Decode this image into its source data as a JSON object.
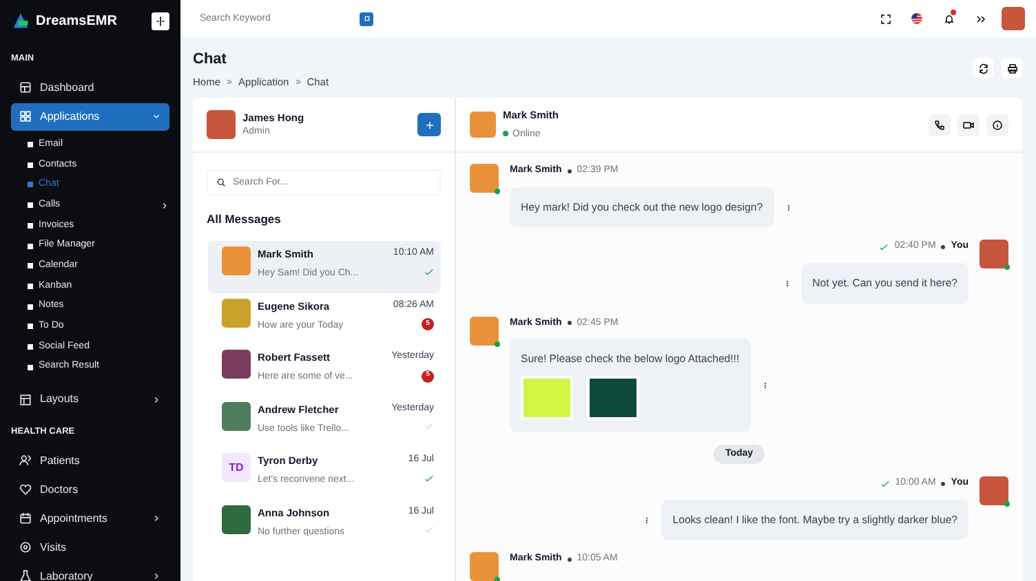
{
  "brand": {
    "name": "DreamsEMR"
  },
  "sidebar": {
    "sections": [
      {
        "title": "MAIN",
        "items": [
          {
            "label": "Dashboard",
            "selected": false,
            "has_submenu": false
          },
          {
            "label": "Applications",
            "selected": true,
            "has_submenu": true,
            "expanded": true,
            "children": [
              {
                "label": "Email",
                "selected": false,
                "has_submenu": false
              },
              {
                "label": "Contacts",
                "selected": false,
                "has_submenu": false
              },
              {
                "label": "Chat",
                "selected": true,
                "has_submenu": false
              },
              {
                "label": "Calls",
                "selected": false,
                "has_submenu": true
              },
              {
                "label": "Invoices",
                "selected": false,
                "has_submenu": false
              },
              {
                "label": "File Manager",
                "selected": false,
                "has_submenu": false
              },
              {
                "label": "Calendar",
                "selected": false,
                "has_submenu": false
              },
              {
                "label": "Kanban",
                "selected": false,
                "has_submenu": false
              },
              {
                "label": "Notes",
                "selected": false,
                "has_submenu": false
              },
              {
                "label": "To Do",
                "selected": false,
                "has_submenu": false
              },
              {
                "label": "Social Feed",
                "selected": false,
                "has_submenu": false
              },
              {
                "label": "Search Result",
                "selected": false,
                "has_submenu": false
              }
            ]
          },
          {
            "label": "Layouts",
            "selected": false,
            "has_submenu": true
          }
        ]
      },
      {
        "title": "HEALTH CARE",
        "items": [
          {
            "label": "Patients",
            "selected": false,
            "has_submenu": false
          },
          {
            "label": "Doctors",
            "selected": false,
            "has_submenu": false
          },
          {
            "label": "Appointments",
            "selected": false,
            "has_submenu": true
          },
          {
            "label": "Visits",
            "selected": false,
            "has_submenu": false
          },
          {
            "label": "Laboratory",
            "selected": false,
            "has_submenu": true
          }
        ]
      }
    ]
  },
  "topbar": {
    "search": {
      "placeholder": "Search Keyword"
    },
    "notification_dot": true
  },
  "page": {
    "title": "Chat",
    "breadcrumb": [
      "Home",
      "Application",
      "Chat"
    ]
  },
  "chat_list": {
    "user": {
      "name": "James Hong",
      "role": "Admin"
    },
    "search": {
      "placeholder": "Search For..."
    },
    "heading": "All Messages",
    "items": [
      {
        "name": "Mark Smith",
        "preview": "Hey Sam! Did you Ch...",
        "time": "10:10 AM",
        "read": true,
        "selected": true
      },
      {
        "name": "Eugene Sikora",
        "preview": "How are your Today",
        "time": "08:26 AM",
        "count": "5",
        "selected": false
      },
      {
        "name": "Robert Fassett",
        "preview": "Here are some of ve...",
        "time": "Yesterday",
        "count": "5",
        "selected": false
      },
      {
        "name": "Andrew Fletcher",
        "preview": "Use tools like Trello...",
        "time": "Yesterday",
        "read": false,
        "selected": false
      },
      {
        "name": "Tyron Derby",
        "initials": "TD",
        "preview": "Let's reconvene next...",
        "time": "16 Jul",
        "read": true,
        "selected": false
      },
      {
        "name": "Anna Johnson",
        "preview": "No further questions",
        "time": "16 Jul",
        "read": false,
        "selected": false
      }
    ]
  },
  "conversation": {
    "contact": {
      "name": "Mark Smith",
      "status": "Online"
    },
    "messages": [
      {
        "kind": "incoming",
        "sender": "Mark Smith",
        "time": "02:39 PM",
        "text": "Hey mark! Did you check out the new logo design?"
      },
      {
        "kind": "outgoing",
        "sender": "You",
        "time": "02:40 PM",
        "text": "Not yet. Can you send it here?"
      },
      {
        "kind": "incoming",
        "sender": "Mark Smith",
        "time": "02:45 PM",
        "text": "Sure! Please check the below logo Attached!!!",
        "has_attachments": true
      },
      {
        "kind": "divider",
        "text": "Today"
      },
      {
        "kind": "outgoing",
        "sender": "You",
        "time": "10:00 AM",
        "text": "Looks clean! I like the font. Maybe try a slightly darker blue?"
      },
      {
        "kind": "incoming",
        "sender": "Mark Smith",
        "time": "10:05 AM"
      }
    ]
  }
}
